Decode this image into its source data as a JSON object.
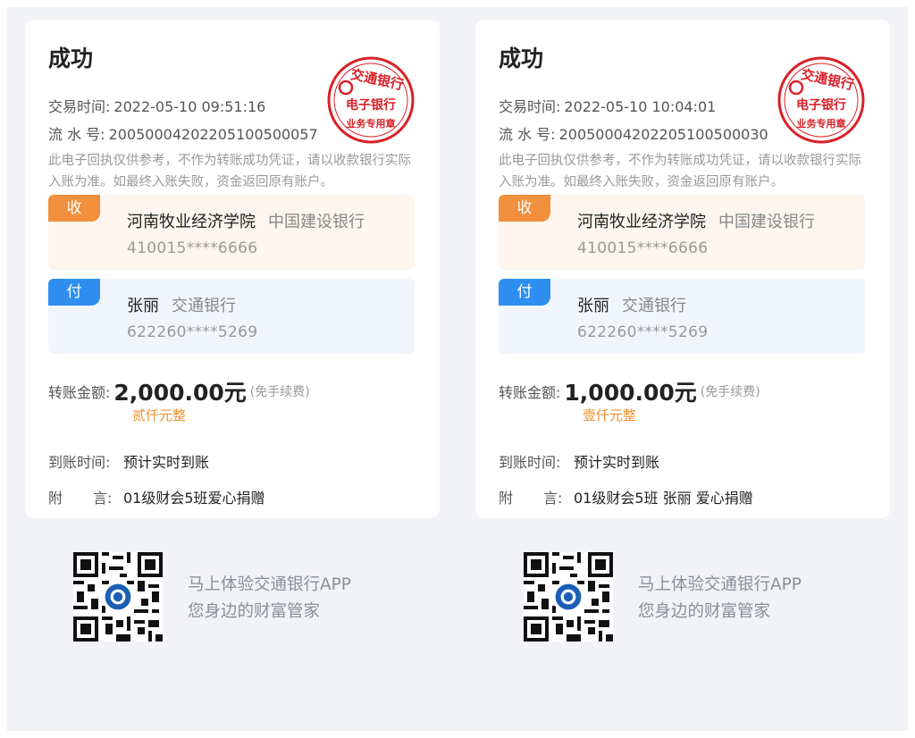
{
  "receipts": [
    {
      "status": "成功",
      "time_label": "交易时间:",
      "time_value": "2022-05-10 09:51:16",
      "serial_label": "流 水 号:",
      "serial_value": "20050004202205100500057",
      "disclaimer": "此电子回执仅供参考，不作为转账成功凭证，请以收款银行实际入账为准。如最终入账失败，资金返回原有账户。",
      "stamp": {
        "top": "交通银行",
        "mid": "电子银行",
        "bottom": "业务专用章"
      },
      "payee": {
        "tag": "收",
        "name": "河南牧业经济学院",
        "bank": "中国建设银行",
        "account": "410015****6666"
      },
      "payer": {
        "tag": "付",
        "name": "张丽",
        "bank": "交通银行",
        "account": "622260****5269"
      },
      "amount_label": "转账金额:",
      "amount_value": "2,000.00元",
      "amount_fee": "(免手续费)",
      "amount_cn": "贰仟元整",
      "arrival_label": "到账时间:",
      "arrival_value": "预计实时到账",
      "memo_label_a": "附",
      "memo_label_b": "言:",
      "memo_value": "01级财会5班爱心捐赠",
      "promo_line1": "马上体验交通银行APP",
      "promo_line2": "您身边的财富管家"
    },
    {
      "status": "成功",
      "time_label": "交易时间:",
      "time_value": "2022-05-10 10:04:01",
      "serial_label": "流 水 号:",
      "serial_value": "20050004202205100500030",
      "disclaimer": "此电子回执仅供参考，不作为转账成功凭证，请以收款银行实际入账为准。如最终入账失败，资金返回原有账户。",
      "stamp": {
        "top": "交通银行",
        "mid": "电子银行",
        "bottom": "业务专用章"
      },
      "payee": {
        "tag": "收",
        "name": "河南牧业经济学院",
        "bank": "中国建设银行",
        "account": "410015****6666"
      },
      "payer": {
        "tag": "付",
        "name": "张丽",
        "bank": "交通银行",
        "account": "622260****5269"
      },
      "amount_label": "转账金额:",
      "amount_value": "1,000.00元",
      "amount_fee": "(免手续费)",
      "amount_cn": "壹仟元整",
      "arrival_label": "到账时间:",
      "arrival_value": "预计实时到账",
      "memo_label_a": "附",
      "memo_label_b": "言:",
      "memo_value": "01级财会5班 张丽 爱心捐赠",
      "promo_line1": "马上体验交通银行APP",
      "promo_line2": "您身边的财富管家"
    }
  ],
  "colors": {
    "payee_tag": "#f0903c",
    "payer_tag": "#2e8ff0",
    "stamp_red": "#d9222a",
    "amount_cn": "#e8922f"
  },
  "icons": {
    "stamp": "bank-seal-icon",
    "qr": "qr-code-icon"
  }
}
